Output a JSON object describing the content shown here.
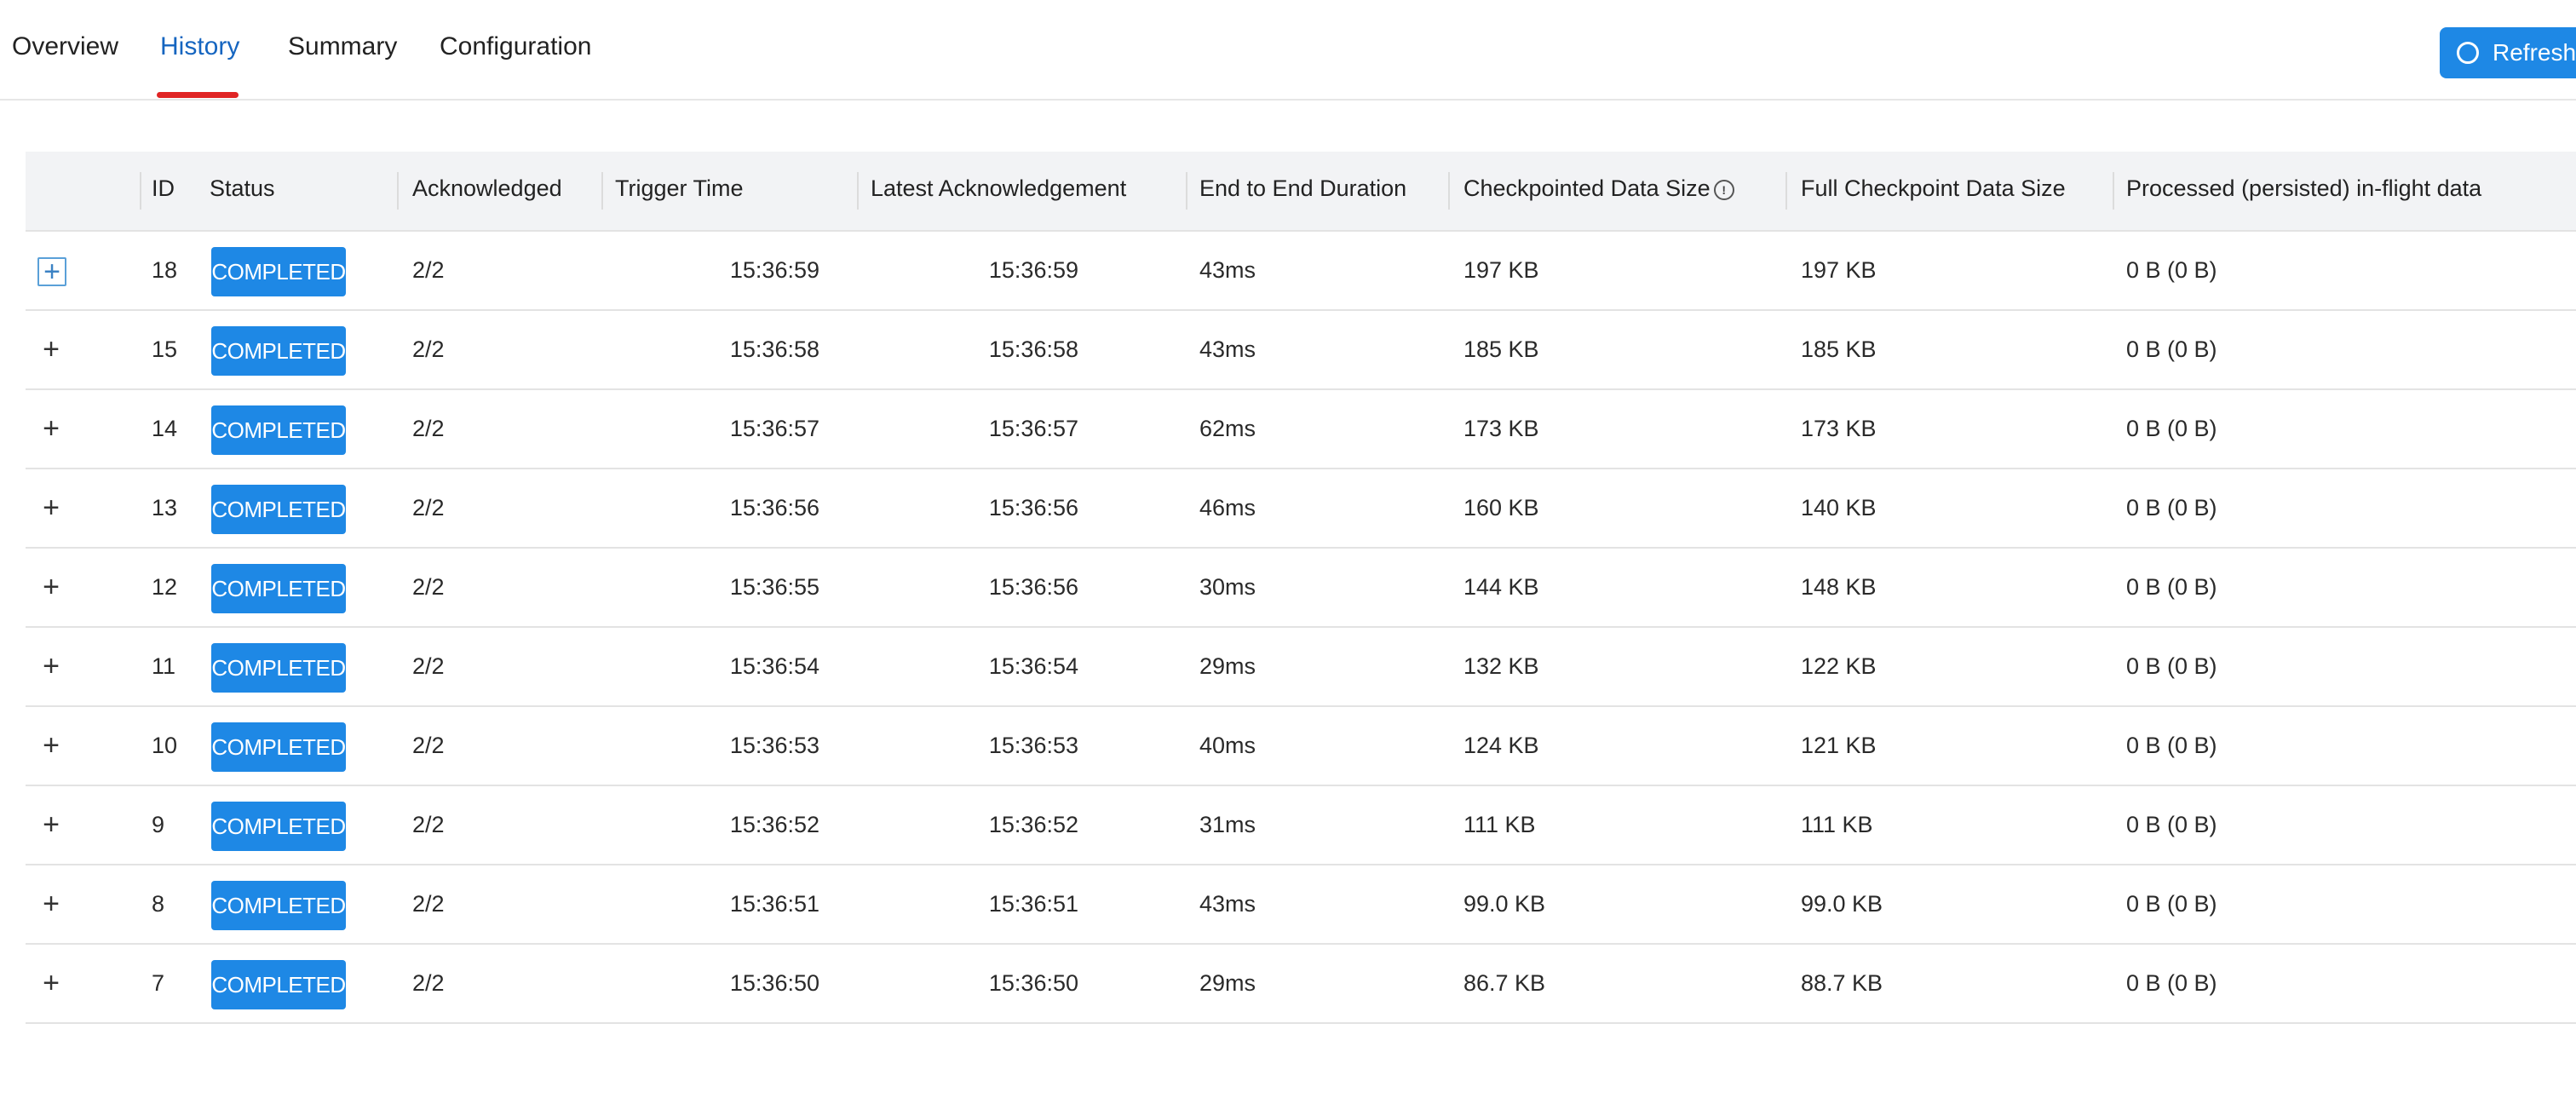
{
  "tabs": [
    {
      "label": "Overview",
      "active": false
    },
    {
      "label": "History",
      "active": true
    },
    {
      "label": "Summary",
      "active": false
    },
    {
      "label": "Configuration",
      "active": false
    }
  ],
  "refresh_label": "Refresh",
  "colors": {
    "accent": "#1e88e5",
    "active_tab_underline": "#e02424"
  },
  "table": {
    "headers": {
      "id": "ID",
      "status": "Status",
      "acknowledged": "Acknowledged",
      "trigger_time": "Trigger Time",
      "latest_ack": "Latest Acknowledgement",
      "e2e_duration": "End to End Duration",
      "checkpointed_size": "Checkpointed Data Size",
      "full_checkpoint_size": "Full Checkpoint Data Size",
      "processed_inflight": "Processed (persisted) in-flight data"
    },
    "rows": [
      {
        "id": "18",
        "status": "COMPLETED",
        "ack": "2/2",
        "trigger": "15:36:59",
        "latest": "15:36:59",
        "duration": "43ms",
        "cp_size": "197 KB",
        "full_size": "197 KB",
        "inflight": "0 B (0 B)"
      },
      {
        "id": "15",
        "status": "COMPLETED",
        "ack": "2/2",
        "trigger": "15:36:58",
        "latest": "15:36:58",
        "duration": "43ms",
        "cp_size": "185 KB",
        "full_size": "185 KB",
        "inflight": "0 B (0 B)"
      },
      {
        "id": "14",
        "status": "COMPLETED",
        "ack": "2/2",
        "trigger": "15:36:57",
        "latest": "15:36:57",
        "duration": "62ms",
        "cp_size": "173 KB",
        "full_size": "173 KB",
        "inflight": "0 B (0 B)"
      },
      {
        "id": "13",
        "status": "COMPLETED",
        "ack": "2/2",
        "trigger": "15:36:56",
        "latest": "15:36:56",
        "duration": "46ms",
        "cp_size": "160 KB",
        "full_size": "140 KB",
        "inflight": "0 B (0 B)"
      },
      {
        "id": "12",
        "status": "COMPLETED",
        "ack": "2/2",
        "trigger": "15:36:55",
        "latest": "15:36:56",
        "duration": "30ms",
        "cp_size": "144 KB",
        "full_size": "148 KB",
        "inflight": "0 B (0 B)"
      },
      {
        "id": "11",
        "status": "COMPLETED",
        "ack": "2/2",
        "trigger": "15:36:54",
        "latest": "15:36:54",
        "duration": "29ms",
        "cp_size": "132 KB",
        "full_size": "122 KB",
        "inflight": "0 B (0 B)"
      },
      {
        "id": "10",
        "status": "COMPLETED",
        "ack": "2/2",
        "trigger": "15:36:53",
        "latest": "15:36:53",
        "duration": "40ms",
        "cp_size": "124 KB",
        "full_size": "121 KB",
        "inflight": "0 B (0 B)"
      },
      {
        "id": "9",
        "status": "COMPLETED",
        "ack": "2/2",
        "trigger": "15:36:52",
        "latest": "15:36:52",
        "duration": "31ms",
        "cp_size": "111 KB",
        "full_size": "111 KB",
        "inflight": "0 B (0 B)"
      },
      {
        "id": "8",
        "status": "COMPLETED",
        "ack": "2/2",
        "trigger": "15:36:51",
        "latest": "15:36:51",
        "duration": "43ms",
        "cp_size": "99.0 KB",
        "full_size": "99.0 KB",
        "inflight": "0 B (0 B)"
      },
      {
        "id": "7",
        "status": "COMPLETED",
        "ack": "2/2",
        "trigger": "15:36:50",
        "latest": "15:36:50",
        "duration": "29ms",
        "cp_size": "86.7 KB",
        "full_size": "88.7 KB",
        "inflight": "0 B (0 B)"
      }
    ]
  }
}
